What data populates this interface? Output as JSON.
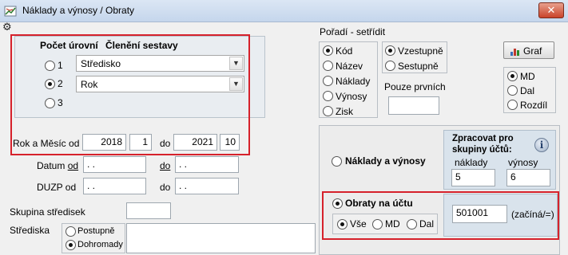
{
  "window": {
    "title": "Náklady a výnosy / Obraty",
    "close_label": "✕"
  },
  "levels": {
    "header_count": "Počet úrovní",
    "header_split": "Členění sestavy",
    "options": [
      {
        "label": "1",
        "value": "Středisko",
        "selected": false
      },
      {
        "label": "2",
        "value": "Rok",
        "selected": true
      },
      {
        "label": "3",
        "selected": false
      }
    ]
  },
  "period": {
    "label_from": "Rok a Měsíc od",
    "year_from": "2018",
    "month_from": "1",
    "label_to": "do",
    "year_to": "2021",
    "month_to": "10"
  },
  "datum": {
    "label_prefix": "Datum ",
    "label_key": "od",
    "from_value": " .  .",
    "to_label": "do",
    "to_value": " .  ."
  },
  "duzp": {
    "label": "DUZP od",
    "from_value": " .  .",
    "to_label": "do",
    "to_value": " .  ."
  },
  "skupina": {
    "label": "Skupina středisek",
    "value": ""
  },
  "strediska": {
    "label": "Střediska",
    "option_postupne": "Postupně",
    "option_dohromady": "Dohromady",
    "selected": "Dohromady",
    "value": ""
  },
  "sort": {
    "title": "Pořadí - setřídit",
    "fields": [
      {
        "label": "Kód",
        "selected": true
      },
      {
        "label": "Název",
        "selected": false
      },
      {
        "label": "Náklady",
        "selected": false
      },
      {
        "label": "Výnosy",
        "selected": false
      },
      {
        "label": "Zisk",
        "selected": false
      }
    ],
    "directions": [
      {
        "label": "Vzestupně",
        "selected": true
      },
      {
        "label": "Sestupně",
        "selected": false
      }
    ],
    "first_only_label": "Pouze prvních",
    "first_only_value": ""
  },
  "graph": {
    "label": "Graf"
  },
  "side": {
    "options": [
      {
        "label": "MD",
        "selected": true
      },
      {
        "label": "Dal",
        "selected": false
      },
      {
        "label": "Rozdíl",
        "selected": false
      }
    ]
  },
  "mode_costs": {
    "label": "Náklady a výnosy",
    "selected": false
  },
  "account_groups": {
    "title": "Zpracovat pro skupiny účtů:",
    "costs_label": "náklady",
    "costs_value": "5",
    "revenues_label": "výnosy",
    "revenues_value": "6",
    "info_icon_char": "i"
  },
  "mode_turnover": {
    "label": "Obraty na účtu",
    "selected": true,
    "sub_options": [
      {
        "label": "Vše",
        "selected": true
      },
      {
        "label": "MD",
        "selected": false
      },
      {
        "label": "Dal",
        "selected": false
      }
    ],
    "account_value": "501001",
    "account_hint": "(začíná/=)"
  },
  "colors": {
    "accent_red": "#d6212b",
    "panel_bg": "#e9edf1",
    "blue_panel": "#d9e3ec"
  }
}
